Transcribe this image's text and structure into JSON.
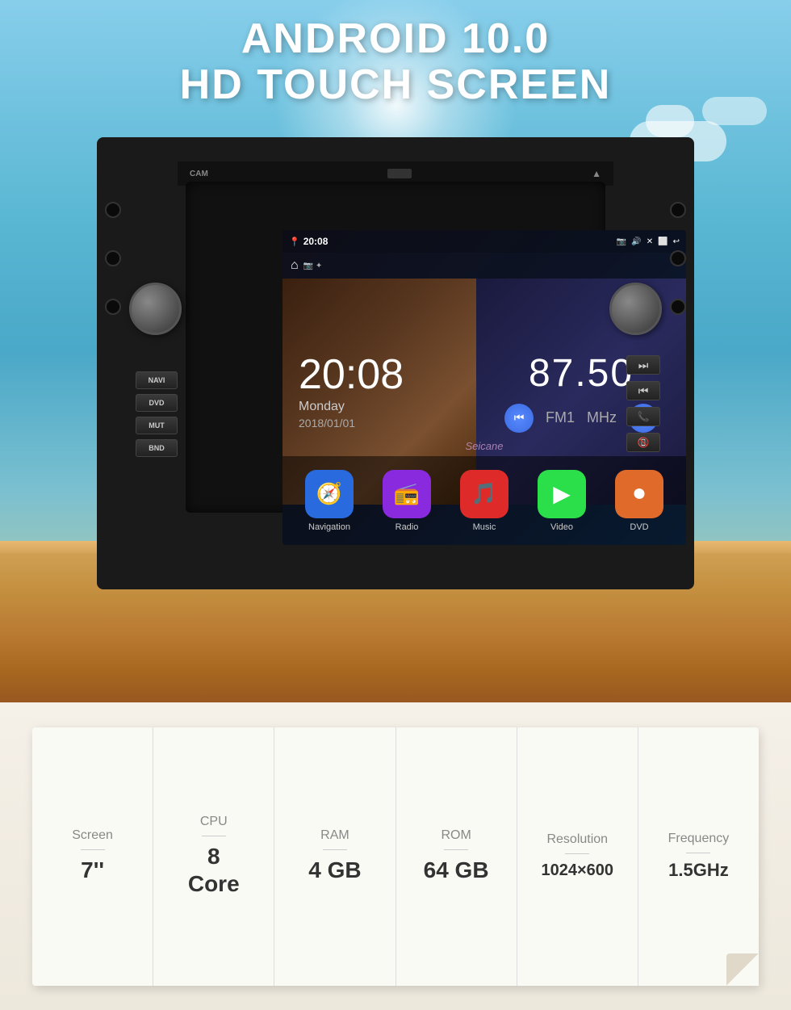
{
  "header": {
    "line1": "ANDROID 10.0",
    "line2": "HD TOUCH SCREEN"
  },
  "screen": {
    "time": "20:08",
    "day": "Monday",
    "date": "2018/01/01",
    "radio_freq": "87.50",
    "radio_band": "FM1",
    "radio_unit": "MHz",
    "watermark": "Seicane"
  },
  "apps": [
    {
      "label": "Navigation",
      "icon": "🧭",
      "class": "app-nav"
    },
    {
      "label": "Radio",
      "icon": "📻",
      "class": "app-radio"
    },
    {
      "label": "Music",
      "icon": "🎵",
      "class": "app-music"
    },
    {
      "label": "Video",
      "icon": "▶",
      "class": "app-video"
    },
    {
      "label": "DVD",
      "icon": "⏺",
      "class": "app-dvd"
    }
  ],
  "left_buttons": [
    "NAVI",
    "DVD",
    "MUT",
    "BND"
  ],
  "specs": [
    {
      "label": "Screen",
      "value": "7''"
    },
    {
      "label": "CPU",
      "value": "8\nCore"
    },
    {
      "label": "RAM",
      "value": "4 GB"
    },
    {
      "label": "ROM",
      "value": "64 GB"
    },
    {
      "label": "Resolution",
      "value": "1024×600"
    },
    {
      "label": "Frequency",
      "value": "1.5GHz"
    }
  ]
}
